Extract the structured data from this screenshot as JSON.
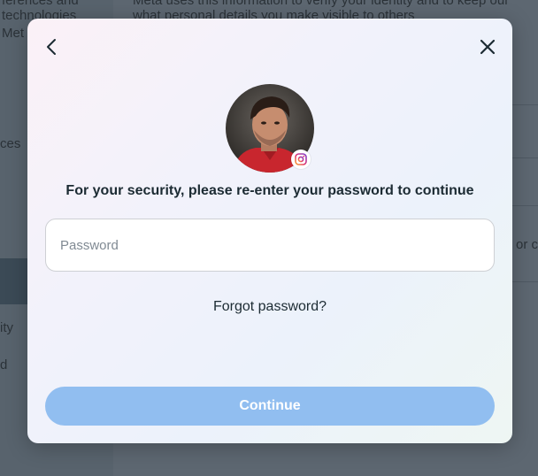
{
  "background": {
    "left_lines": [
      "ferences and",
      "technologies",
      "Met",
      "ces",
      "ity",
      "d"
    ],
    "right_lines": [
      "Meta uses this information to verify your identity and to keep our",
      "what personal details you make visible to others"
    ],
    "right_fragment": "or c"
  },
  "modal": {
    "back_icon": "chevron-left-icon",
    "close_icon": "close-icon",
    "badge_icon": "instagram-icon",
    "prompt": "For your security, please re-enter your password to continue",
    "password_placeholder": "Password",
    "password_value": "",
    "forgot_label": "Forgot password?",
    "continue_label": "Continue"
  },
  "colors": {
    "continue_disabled": "#91bef0",
    "text_primary": "#1c2b33"
  }
}
